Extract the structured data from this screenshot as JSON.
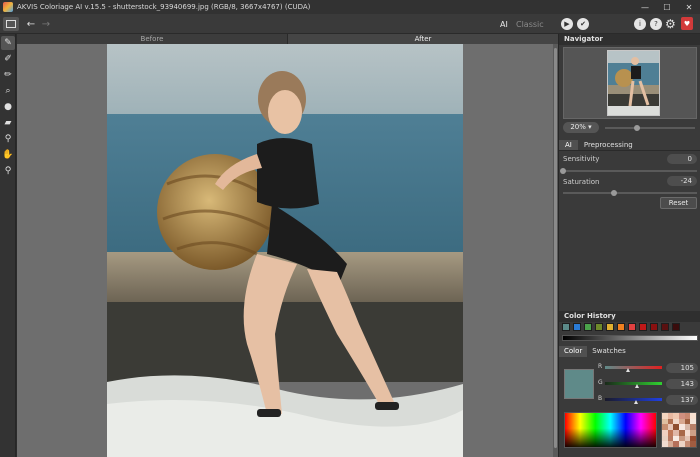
{
  "window": {
    "title": "AKVIS Coloriage AI v.15.5 - shutterstock_93940699.jpg (RGB/8, 3667x4767) (CUDA)",
    "controls": {
      "minimize": "—",
      "maximize": "☐",
      "close": "✕"
    }
  },
  "toolbar": {
    "undo": "←",
    "redo": "→",
    "mode_ai": "AI",
    "mode_classic": "Classic",
    "run": "▶",
    "apply": "✔",
    "info": "i",
    "help": "?",
    "settings": "⚙",
    "donate": "♥"
  },
  "tools": [
    {
      "name": "pencil-tool",
      "glyph": "✎"
    },
    {
      "name": "keep-color-tool",
      "glyph": "✐"
    },
    {
      "name": "chameleon-tool",
      "glyph": "✏"
    },
    {
      "name": "magic-tube-tool",
      "glyph": "⌕"
    },
    {
      "name": "paint-tool",
      "glyph": "●"
    },
    {
      "name": "eraser-tool",
      "glyph": "▰"
    },
    {
      "name": "eyedropper-tool",
      "glyph": "⚲"
    },
    {
      "name": "hand-tool",
      "glyph": "✋"
    },
    {
      "name": "zoom-tool",
      "glyph": "⚲"
    }
  ],
  "view_tabs": {
    "before": "Before",
    "after": "After"
  },
  "navigator": {
    "title": "Navigator",
    "zoom": "20%",
    "zoom_arrow": "▾",
    "zoom_level": 0.35
  },
  "settings_tabs": {
    "ai": "AI",
    "preprocessing": "Preprocessing"
  },
  "params": {
    "sensitivity_label": "Sensitivity",
    "sensitivity_value": "0",
    "sensitivity_level": 0.0,
    "saturation_label": "Saturation",
    "saturation_value": "-24",
    "saturation_level": 0.38,
    "reset": "Reset"
  },
  "color_history": {
    "title": "Color History",
    "colors": [
      "#5b8a89",
      "#2a7bd6",
      "#4aa34a",
      "#6e8a2a",
      "#e0b030",
      "#f08020",
      "#e04040",
      "#c01818",
      "#8a1010",
      "#5a1010",
      "#3a0c0c"
    ]
  },
  "color_tabs": {
    "color": "Color",
    "swatches": "Swatches"
  },
  "current_color": {
    "hex": "#5f8a89",
    "r_label": "R",
    "r": "105",
    "g_label": "G",
    "g": "143",
    "b_label": "B",
    "b": "137"
  },
  "mini_swatches": [
    "#f4d6c0",
    "#e8b8a0",
    "#f0c8b0",
    "#d09080",
    "#c88870",
    "#f8e0d0",
    "#e0c0a0",
    "#b07050",
    "#f0d8c8",
    "#d8a890",
    "#a06040",
    "#f4e4d8",
    "#c89070",
    "#e8c8b8",
    "#905030",
    "#f8e8e0",
    "#d8b8a8",
    "#b88068",
    "#f0d0c0",
    "#c07858",
    "#e0b8a8",
    "#a86848",
    "#f4dcd0",
    "#d0a088",
    "#e8d0c0",
    "#b87860",
    "#f8ece4",
    "#c89880",
    "#e4c4b4",
    "#984c30",
    "#f0dcd0",
    "#d4aa94",
    "#b4705a",
    "#ecd4c6",
    "#c48c74",
    "#a05c40"
  ]
}
